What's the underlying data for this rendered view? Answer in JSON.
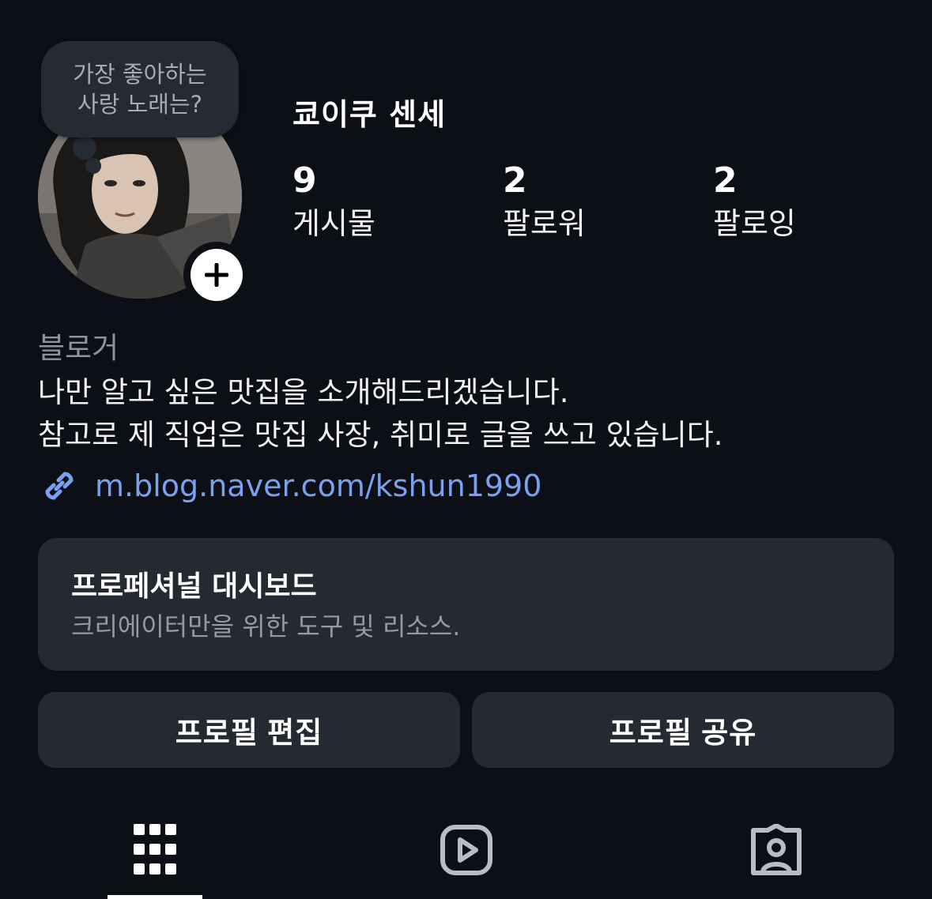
{
  "profile": {
    "note_line1": "가장 좋아하는",
    "note_line2": "사랑 노래는?",
    "username": "쿄이쿠 센세",
    "add_icon": "plus-icon"
  },
  "stats": [
    {
      "count": "9",
      "label": "게시물"
    },
    {
      "count": "2",
      "label": "팔로워"
    },
    {
      "count": "2",
      "label": "팔로잉"
    }
  ],
  "bio": {
    "category": "블로거",
    "line1": "나만 알고 싶은 맛집을 소개해드리겠습니다.",
    "line2": "참고로 제 직업은 맛집 사장, 취미로 글을 쓰고 있습니다.",
    "link": "m.blog.naver.com/kshun1990",
    "link_icon": "link-icon"
  },
  "dashboard": {
    "title": "프로페셔널 대시보드",
    "subtitle": "크리에이터만을 위한 도구 및 리소스."
  },
  "actions": {
    "edit_label": "프로필 편집",
    "share_label": "프로필 공유"
  },
  "tabs": [
    {
      "icon": "grid-icon",
      "active": true
    },
    {
      "icon": "reels-icon",
      "active": false
    },
    {
      "icon": "tagged-icon",
      "active": false
    }
  ],
  "colors": {
    "background": "#0c0f16",
    "card": "#252932",
    "link": "#7aa0ee",
    "muted": "#8e939c"
  }
}
